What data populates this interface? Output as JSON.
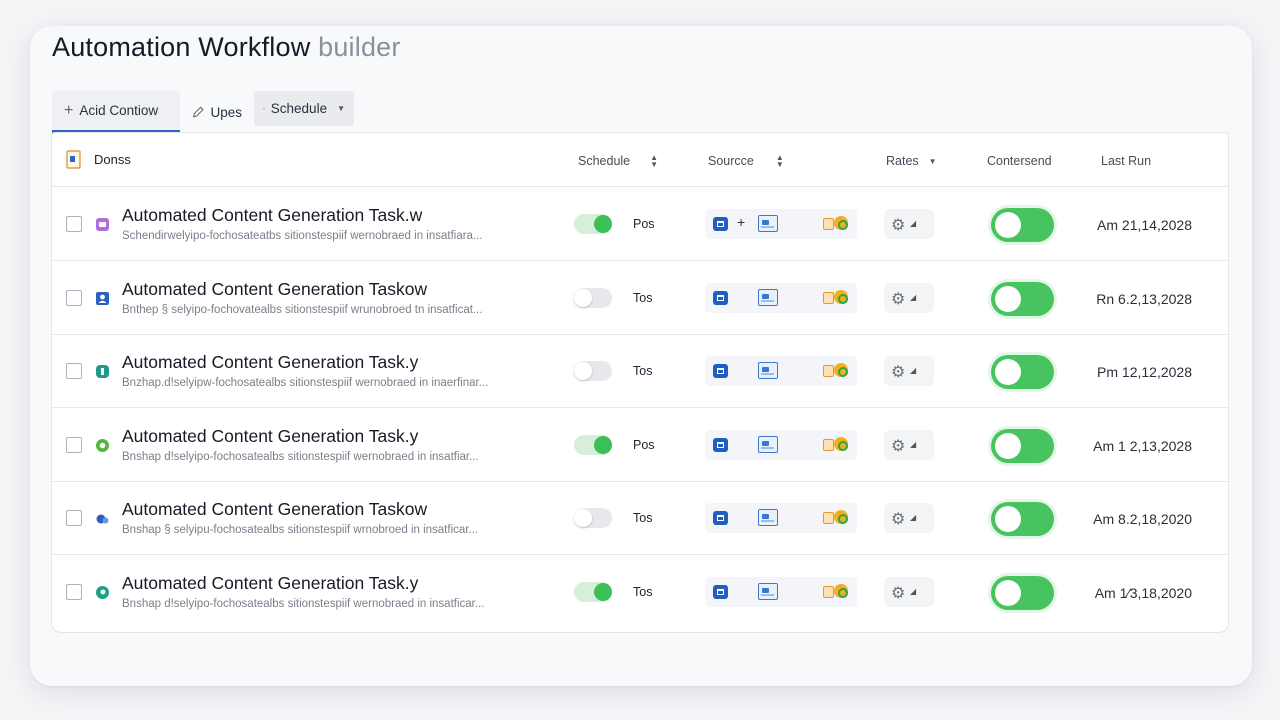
{
  "page": {
    "title_main": "Automation Workflow",
    "title_sub": "builder"
  },
  "toolbar": {
    "add_label": "Acid Contiow",
    "upes_label": "Upes",
    "schedule_label": "Schedule"
  },
  "table": {
    "columns": {
      "name": "Donss",
      "schedule": "Schedule",
      "source": "Sourcce",
      "rates": "Rates",
      "contersend": "Contersend",
      "last_run": "Last Run"
    },
    "rows": [
      {
        "name": "Automated Content Generation Task.w",
        "desc": "Schendirwelyipo-fochosateatbs sitionstespiif wernobraed in insatfiara...",
        "schedule_on": true,
        "schedule_label": "Pos",
        "has_plus": true,
        "enabled": true,
        "last_run": "Am 21,14,2028",
        "icon": "purple-square-icon"
      },
      {
        "name": "Automated Content Generation Taskow",
        "desc": "Bnthep § selyipo-fochovatealbs sitionstespiif wrunobroed tn insatficat...",
        "schedule_on": false,
        "schedule_label": "Tos",
        "has_plus": false,
        "enabled": true,
        "last_run": "Rn 6.2,13,2028",
        "icon": "blue-person-icon"
      },
      {
        "name": "Automated Content Generation Task.y",
        "desc": "Bnzhap.d!selyipw-fochosatealbs sitionstespiif wernobraed in inaerfinar...",
        "schedule_on": false,
        "schedule_label": "Tos",
        "has_plus": false,
        "enabled": true,
        "last_run": "Pm 12,12,2028",
        "icon": "teal-badge-icon"
      },
      {
        "name": "Automated Content Generation Task.y",
        "desc": "Bnshap d!selyipo-fochosatealbs sitionstespiif wernobraed in insatfiar...",
        "schedule_on": true,
        "schedule_label": "Pos",
        "has_plus": false,
        "enabled": true,
        "last_run": "Am 1 2,13,2028",
        "icon": "green-circle-icon"
      },
      {
        "name": "Automated Content Generation Taskow",
        "desc": "Bnshap § selyipu-fochosatealbs sitionstespiif wrnobroed in insatficar...",
        "schedule_on": false,
        "schedule_label": "Tos",
        "has_plus": false,
        "enabled": true,
        "last_run": "Am 8.2,18,2020",
        "icon": "blue-cloud-icon"
      },
      {
        "name": "Automated Content Generation Task.y",
        "desc": "Bnshap d!selyipo-fochosatealbs sitionstespiif wernobraed in insatficar...",
        "schedule_on": true,
        "schedule_label": "Tos",
        "has_plus": false,
        "enabled": true,
        "last_run": "Am 1⁄3,18,2020",
        "icon": "teal-circle-icon"
      }
    ]
  },
  "colors": {
    "accent": "#2f66c4",
    "toggle_on": "#3cbf57",
    "source_blue": "#1f5fbf"
  }
}
